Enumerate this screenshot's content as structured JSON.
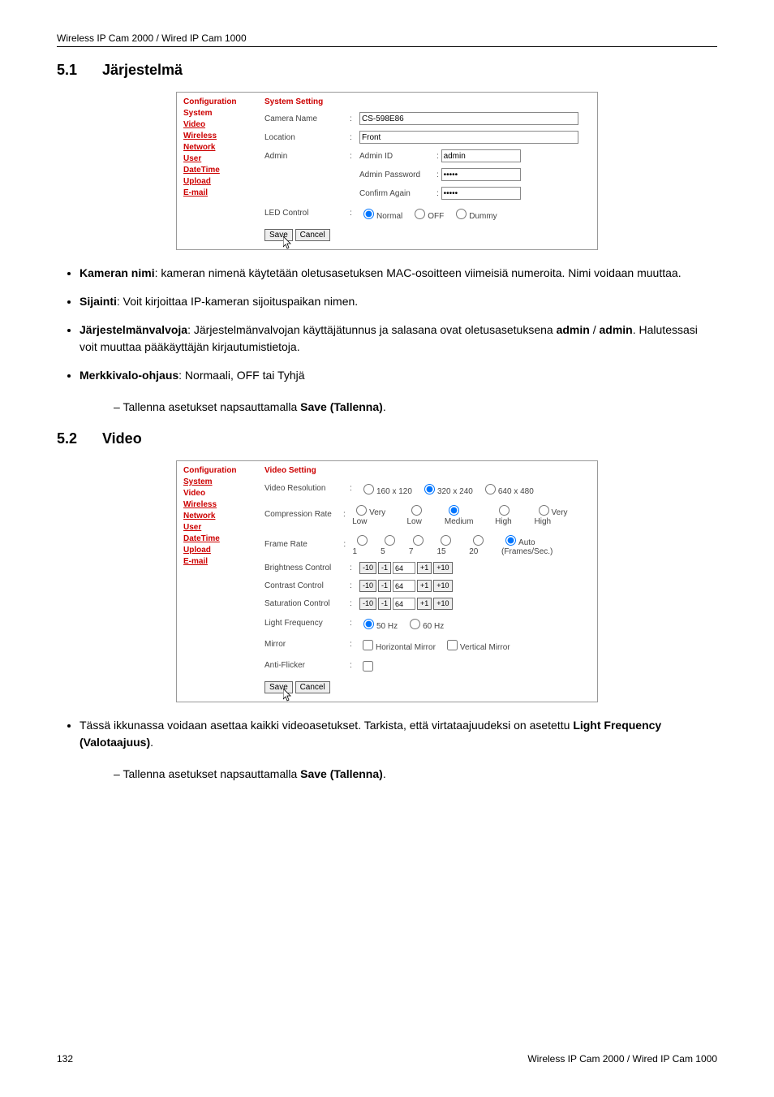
{
  "header": "Wireless IP Cam 2000 / Wired IP Cam 1000",
  "footer": {
    "page": "132",
    "right": "Wireless IP Cam 2000 / Wired IP Cam 1000"
  },
  "sec51": {
    "num": "5.1",
    "title": "Järjestelmä"
  },
  "sec52": {
    "num": "5.2",
    "title": "Video"
  },
  "nav": {
    "title": "Configuration",
    "system": "System",
    "video": "Video",
    "wireless": "Wireless",
    "network": "Network",
    "user": "User",
    "datetime": "DateTime",
    "upload": "Upload",
    "email": "E-mail"
  },
  "panel1": {
    "title": "System Setting",
    "camera_name_label": "Camera Name",
    "camera_name_value": "CS-598E86",
    "location_label": "Location",
    "location_value": "Front",
    "admin_label": "Admin",
    "admin_id_label": "Admin ID",
    "admin_id_value": "admin",
    "admin_pw_label": "Admin Password",
    "admin_pw_value": "•••••",
    "confirm_label": "Confirm Again",
    "confirm_value": "•••••",
    "led_label": "LED Control",
    "led_normal": "Normal",
    "led_off": "OFF",
    "led_dummy": "Dummy",
    "save": "Save",
    "cancel": "Cancel"
  },
  "panel2": {
    "title": "Video Setting",
    "res_label": "Video Resolution",
    "res_160": "160 x 120",
    "res_320": "320 x 240",
    "res_640": "640 x 480",
    "comp_label": "Compression Rate",
    "comp_vl": "Very Low",
    "comp_l": "Low",
    "comp_m": "Medium",
    "comp_h": "High",
    "comp_vh": "Very High",
    "frame_label": "Frame Rate",
    "frame_1": "1",
    "frame_5": "5",
    "frame_7": "7",
    "frame_15": "15",
    "frame_20": "20",
    "frame_auto": "Auto  (Frames/Sec.)",
    "bright_label": "Brightness Control",
    "contrast_label": "Contrast Control",
    "sat_label": "Saturation Control",
    "step_m10": "-10",
    "step_m1": "-1",
    "step_val": "64",
    "step_p1": "+1",
    "step_p10": "+10",
    "lf_label": "Light Frequency",
    "lf_50": "50 Hz",
    "lf_60": "60 Hz",
    "mirror_label": "Mirror",
    "mirror_h": "Horizontal Mirror",
    "mirror_v": "Vertical Mirror",
    "af_label": "Anti-Flicker",
    "save": "Save",
    "cancel": "Cancel"
  },
  "bullets1": {
    "b1a": "Kameran nimi",
    "b1b": ": kameran nimenä käytetään oletusasetuksen MAC-osoitteen viimeisiä numeroita. Nimi voidaan muuttaa.",
    "b2a": "Sijainti",
    "b2b": ": Voit kirjoittaa IP-kameran sijoituspaikan nimen.",
    "b3a": "Järjestelmänvalvoja",
    "b3b": ": Järjestelmänvalvojan käyttäjätunnus ja salasana ovat oletusasetuksena ",
    "b3c": "admin",
    "b3d": " / ",
    "b3e": "admin",
    "b3f": ". Halutessasi voit muuttaa pääkäyttäjän kirjautumistietoja.",
    "b4a": "Merkkivalo-ohjaus",
    "b4b": ": Normaali, OFF tai Tyhjä"
  },
  "dash": {
    "d1a": "Tallenna asetukset napsauttamalla ",
    "d1b": "Save (Tallenna)",
    "d1c": "."
  },
  "bullets2": {
    "b1a": "Tässä ikkunassa voidaan asettaa kaikki videoasetukset. Tarkista, että virtataajuudeksi on asetettu ",
    "b1b": "Light Frequency (Valotaajuus)",
    "b1c": "."
  }
}
